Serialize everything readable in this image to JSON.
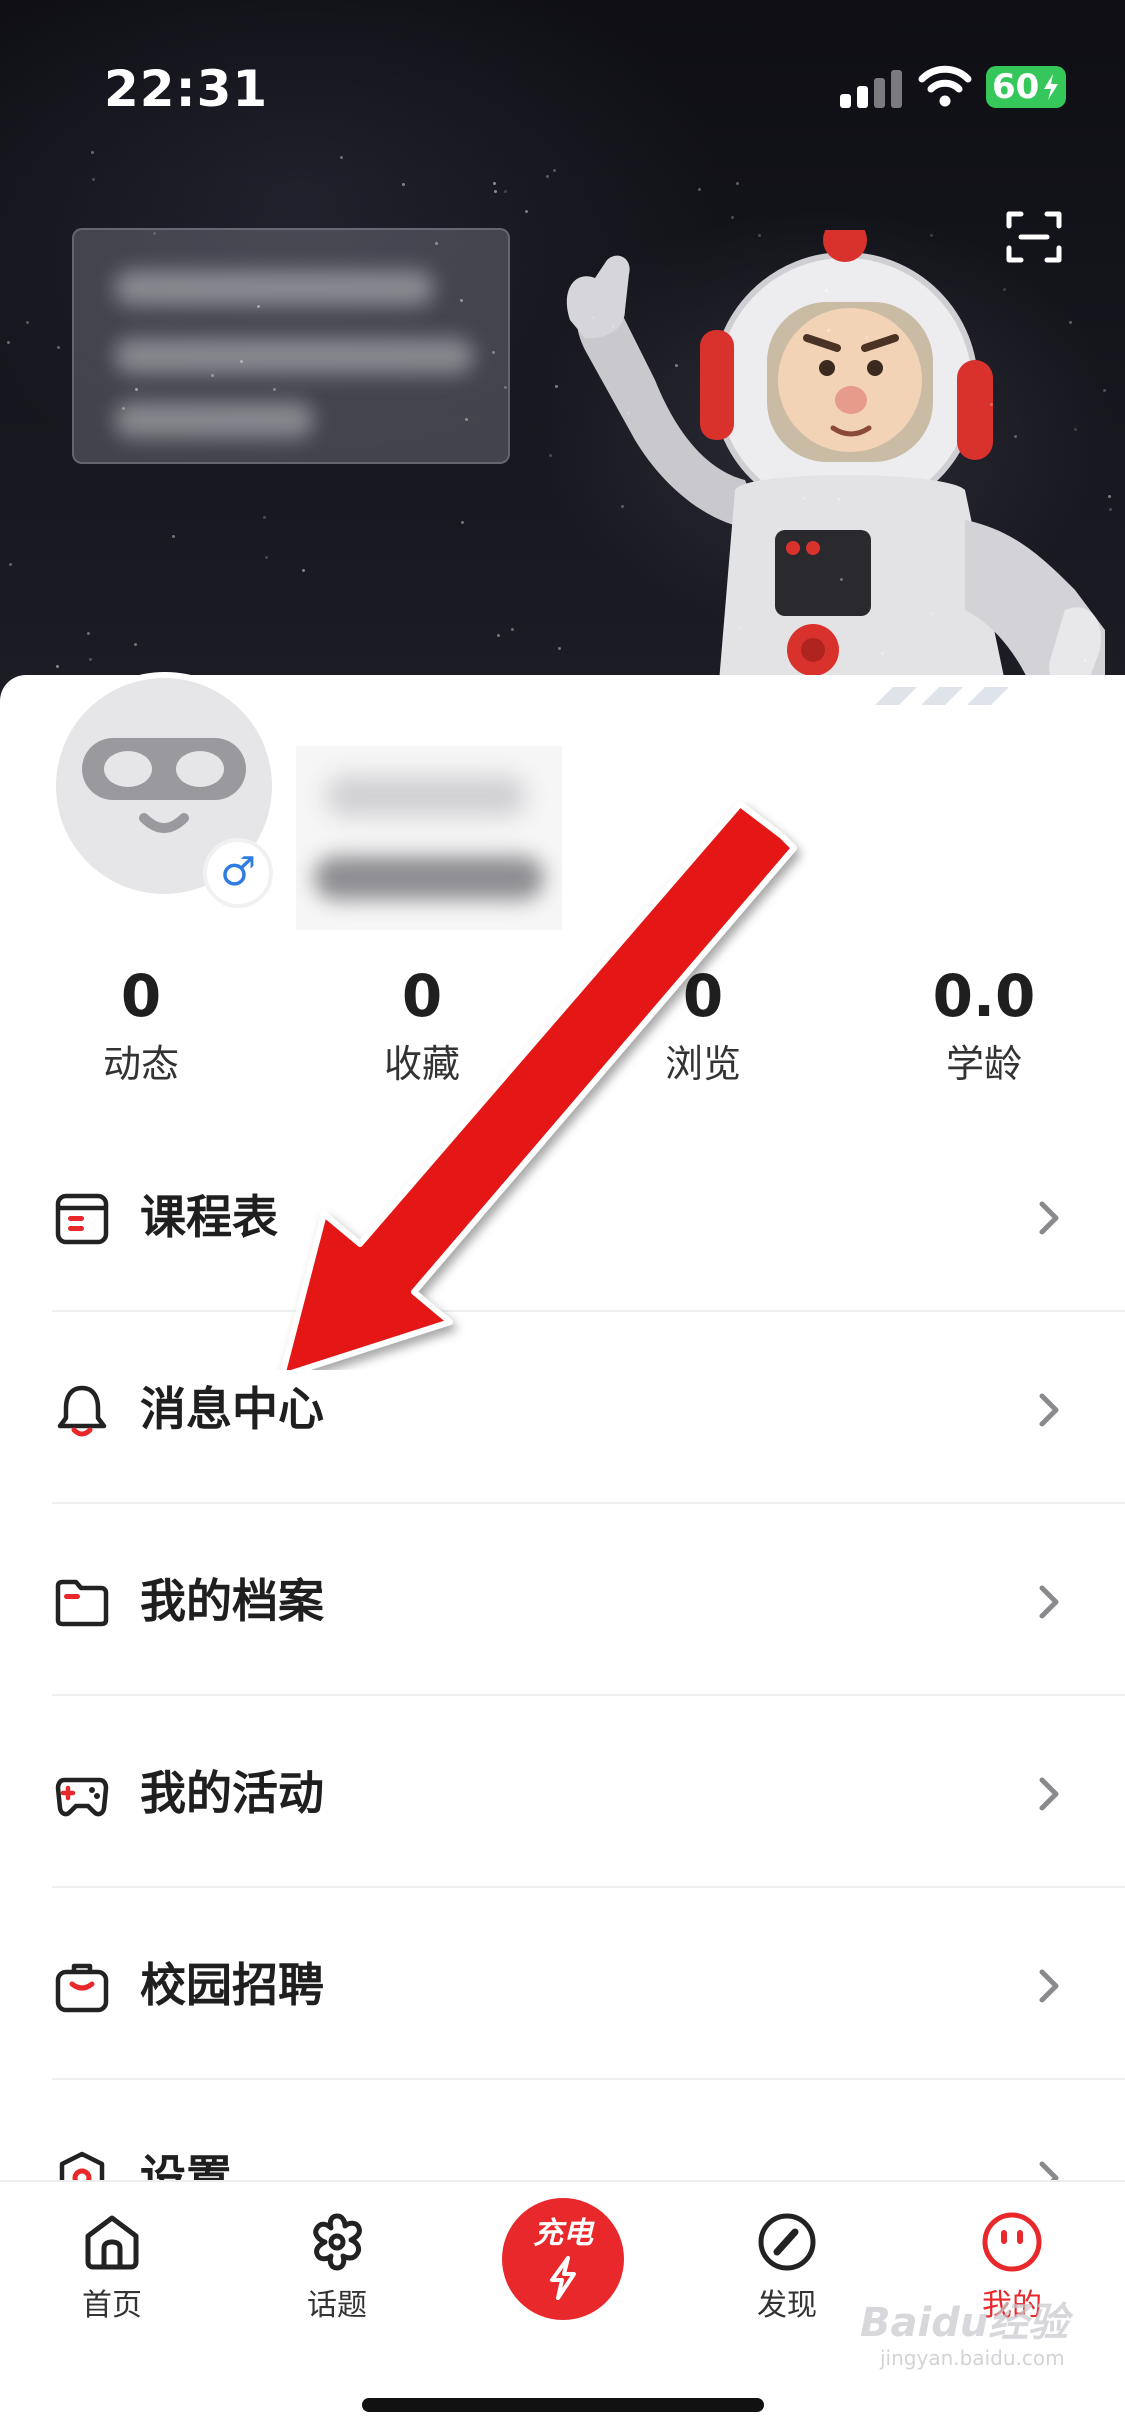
{
  "status_bar": {
    "time": "22:31",
    "battery": "60",
    "icons": [
      "signal-icon",
      "wifi-icon",
      "battery-charging-icon"
    ]
  },
  "header": {
    "scan_icon": "scan-icon"
  },
  "profile": {
    "gender_symbol": "♂"
  },
  "stats": [
    {
      "value": "0",
      "label": "动态"
    },
    {
      "value": "0",
      "label": "收藏"
    },
    {
      "value": "0",
      "label": "浏览"
    },
    {
      "value": "0.0",
      "label": "学龄"
    }
  ],
  "menu": [
    {
      "label": "课程表",
      "icon": "calendar-icon"
    },
    {
      "label": "消息中心",
      "icon": "bell-icon"
    },
    {
      "label": "我的档案",
      "icon": "folder-icon"
    },
    {
      "label": "我的活动",
      "icon": "gamepad-icon"
    },
    {
      "label": "校园招聘",
      "icon": "briefcase-icon"
    },
    {
      "label": "设置",
      "icon": "settings-icon"
    }
  ],
  "tabbar": {
    "items": [
      {
        "label": "首页",
        "icon": "home-icon"
      },
      {
        "label": "话题",
        "icon": "topic-icon"
      },
      {
        "label": "发现",
        "icon": "compass-icon"
      },
      {
        "label": "我的",
        "icon": "mascot-icon"
      }
    ],
    "center_label": "充电",
    "active": "我的"
  },
  "colors": {
    "accent": "#e8282b",
    "battery": "#35c759",
    "gender": "#2f7de1"
  },
  "watermark": {
    "text": "Baidu经验",
    "sub": "jingyan.baidu.com"
  }
}
